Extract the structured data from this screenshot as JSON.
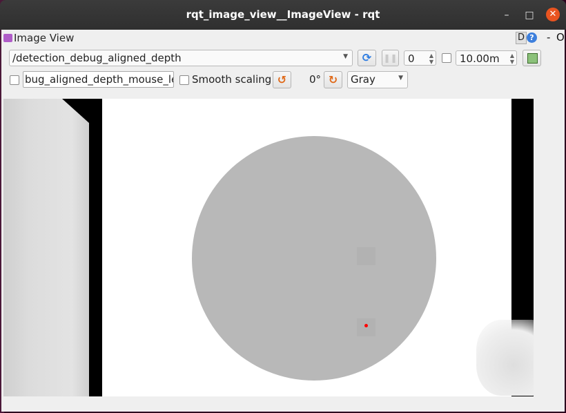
{
  "window": {
    "title": "rqt_image_view__ImageView - rqt",
    "minimize": "–",
    "maximize": "□",
    "close": "✕"
  },
  "panel": {
    "title": "Image View",
    "dock_d": "D",
    "dock_help": "?",
    "dock_dash": "-",
    "dock_o": "O"
  },
  "toolbar": {
    "topic": "/detection_debug_aligned_depth",
    "fps_value": "0",
    "max_depth": "10.00m",
    "mouse_topic": "bug_aligned_depth_mouse_left",
    "smooth_label": "Smooth scaling",
    "rotation": "0°",
    "colormap": "Gray"
  },
  "icons": {
    "panel": "image-view-icon",
    "refresh": "refresh-icon",
    "pause": "pause-icon",
    "save": "save-icon",
    "rotate_left": "rotate-left-icon",
    "rotate_right": "rotate-right-icon"
  }
}
